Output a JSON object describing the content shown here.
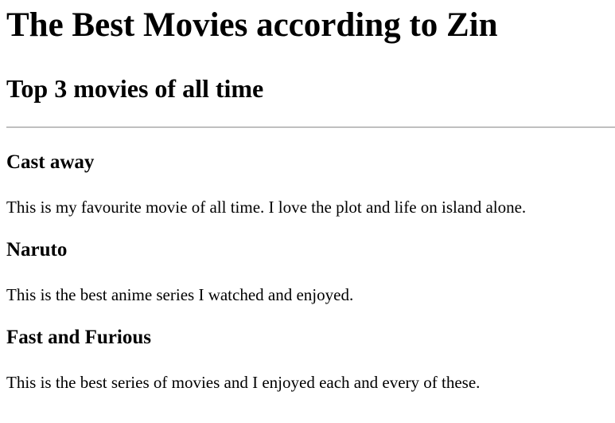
{
  "page": {
    "title": "The Best Movies according to Zin",
    "subtitle": "Top 3 movies of all time"
  },
  "movies": [
    {
      "name": "Cast away",
      "description": "This is my favourite movie of all time. I love the plot and life on island alone."
    },
    {
      "name": "Naruto",
      "description": "This is the best anime series I watched and enjoyed."
    },
    {
      "name": "Fast and Furious",
      "description": "This is the best series of movies and I enjoyed each and every of these."
    }
  ]
}
